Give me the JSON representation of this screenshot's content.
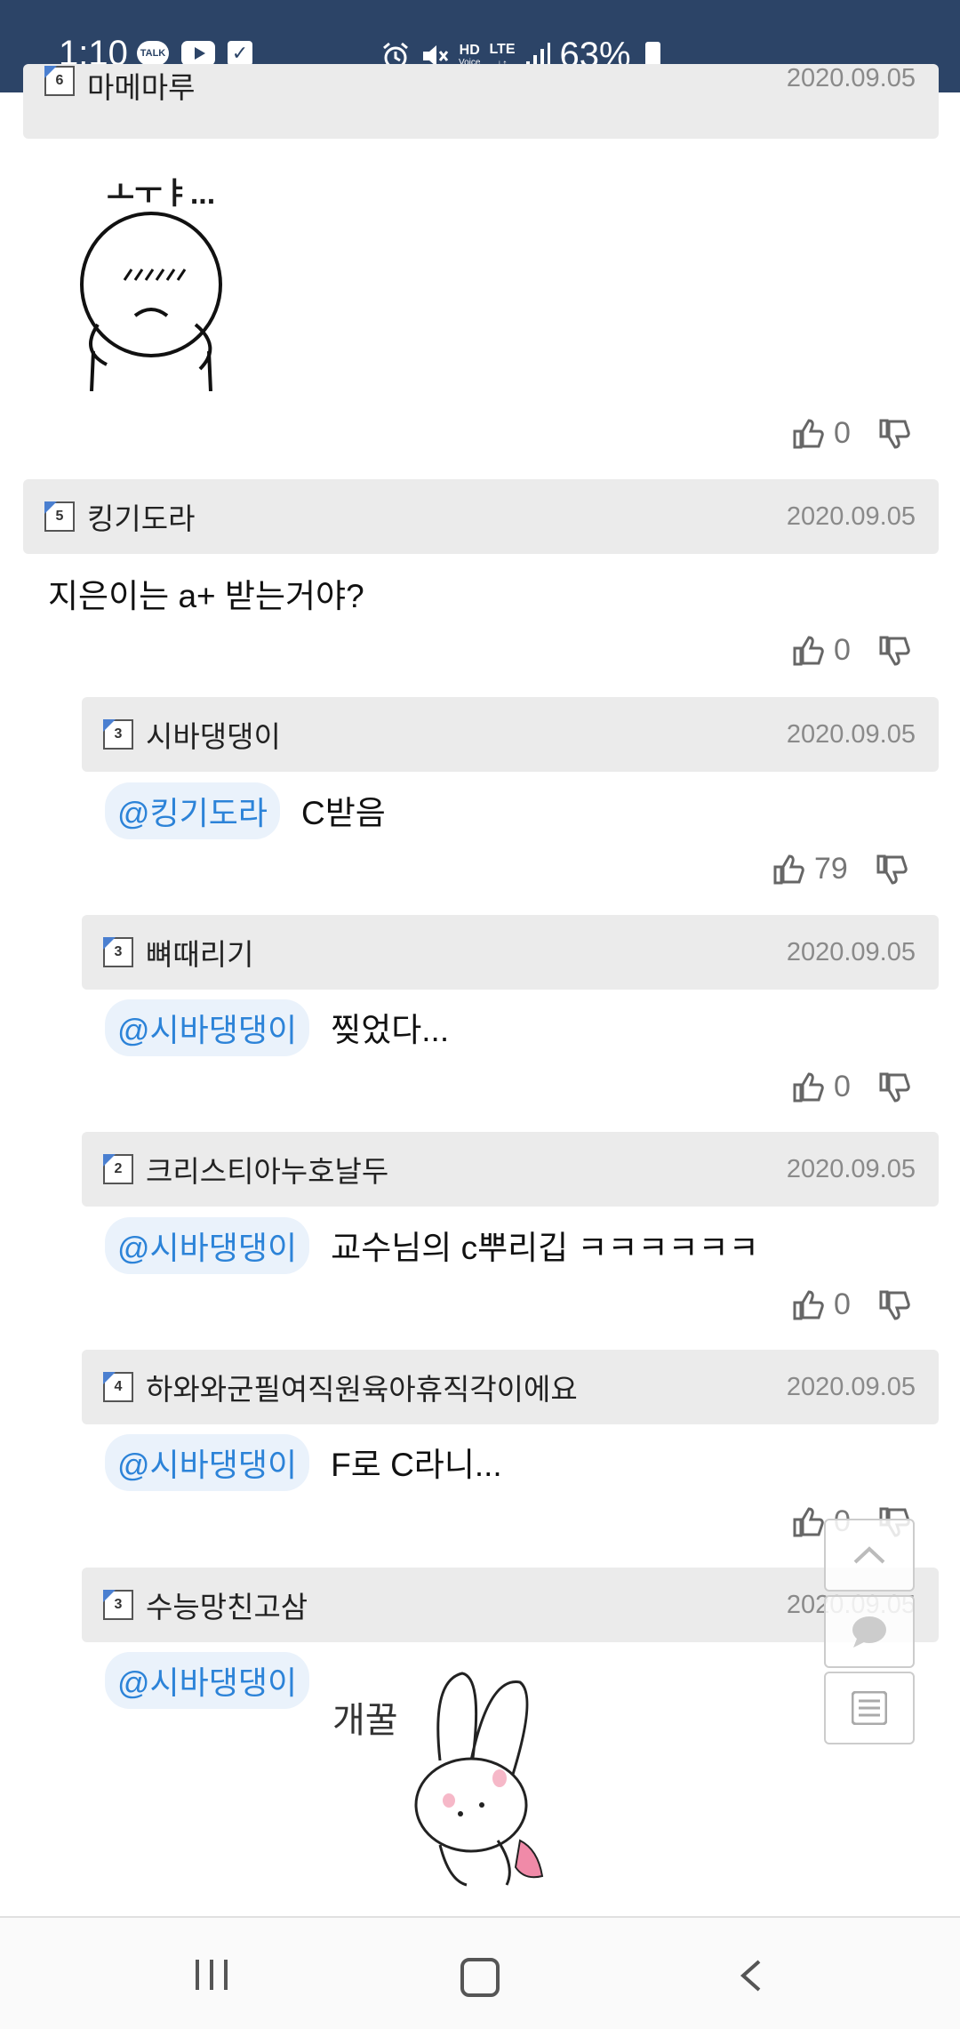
{
  "status": {
    "time": "1:10",
    "talk": "TALK",
    "hd": "HD",
    "lte": "LTE",
    "battery": "63%"
  },
  "comments": [
    {
      "level": "6",
      "author": "마메마루",
      "date": "2020.09.05",
      "text": "",
      "mention": "",
      "image_caption": "ㅗㅜㅑ...",
      "likes": "0"
    },
    {
      "level": "5",
      "author": "킹기도라",
      "date": "2020.09.05",
      "text": "지은이는 a+ 받는거야?",
      "mention": "",
      "likes": "0"
    },
    {
      "level": "3",
      "author": "시바댕댕이",
      "date": "2020.09.05",
      "mention": "@킹기도라",
      "text": "C받음",
      "likes": "79"
    },
    {
      "level": "3",
      "author": "뼈때리기",
      "date": "2020.09.05",
      "mention": "@시바댕댕이",
      "text": "찢었다...",
      "likes": "0"
    },
    {
      "level": "2",
      "author": "크리스티아누호날두",
      "date": "2020.09.05",
      "mention": "@시바댕댕이",
      "text": "교수님의 c뿌리깁 ㅋㅋㅋㅋㅋㅋ",
      "likes": "0"
    },
    {
      "level": "4",
      "author": "하와와군필여직원육아휴직각이에요",
      "date": "2020.09.05",
      "mention": "@시바댕댕이",
      "text": "F로 C라니...",
      "likes": "0"
    },
    {
      "level": "3",
      "author": "수능망친고삼",
      "date": "2020.09.05",
      "mention": "@시바댕댕이",
      "text": "",
      "image_caption": "개꿀"
    }
  ],
  "icons": {
    "like": "thumbs-up-icon",
    "dislike": "thumbs-down-icon",
    "scroll_top": "chevron-up-icon",
    "comment": "comment-icon",
    "list": "list-icon"
  },
  "colors": {
    "status_bar": "#2c4467",
    "mention": "#2c83d8",
    "header_bg": "#ebebeb"
  }
}
